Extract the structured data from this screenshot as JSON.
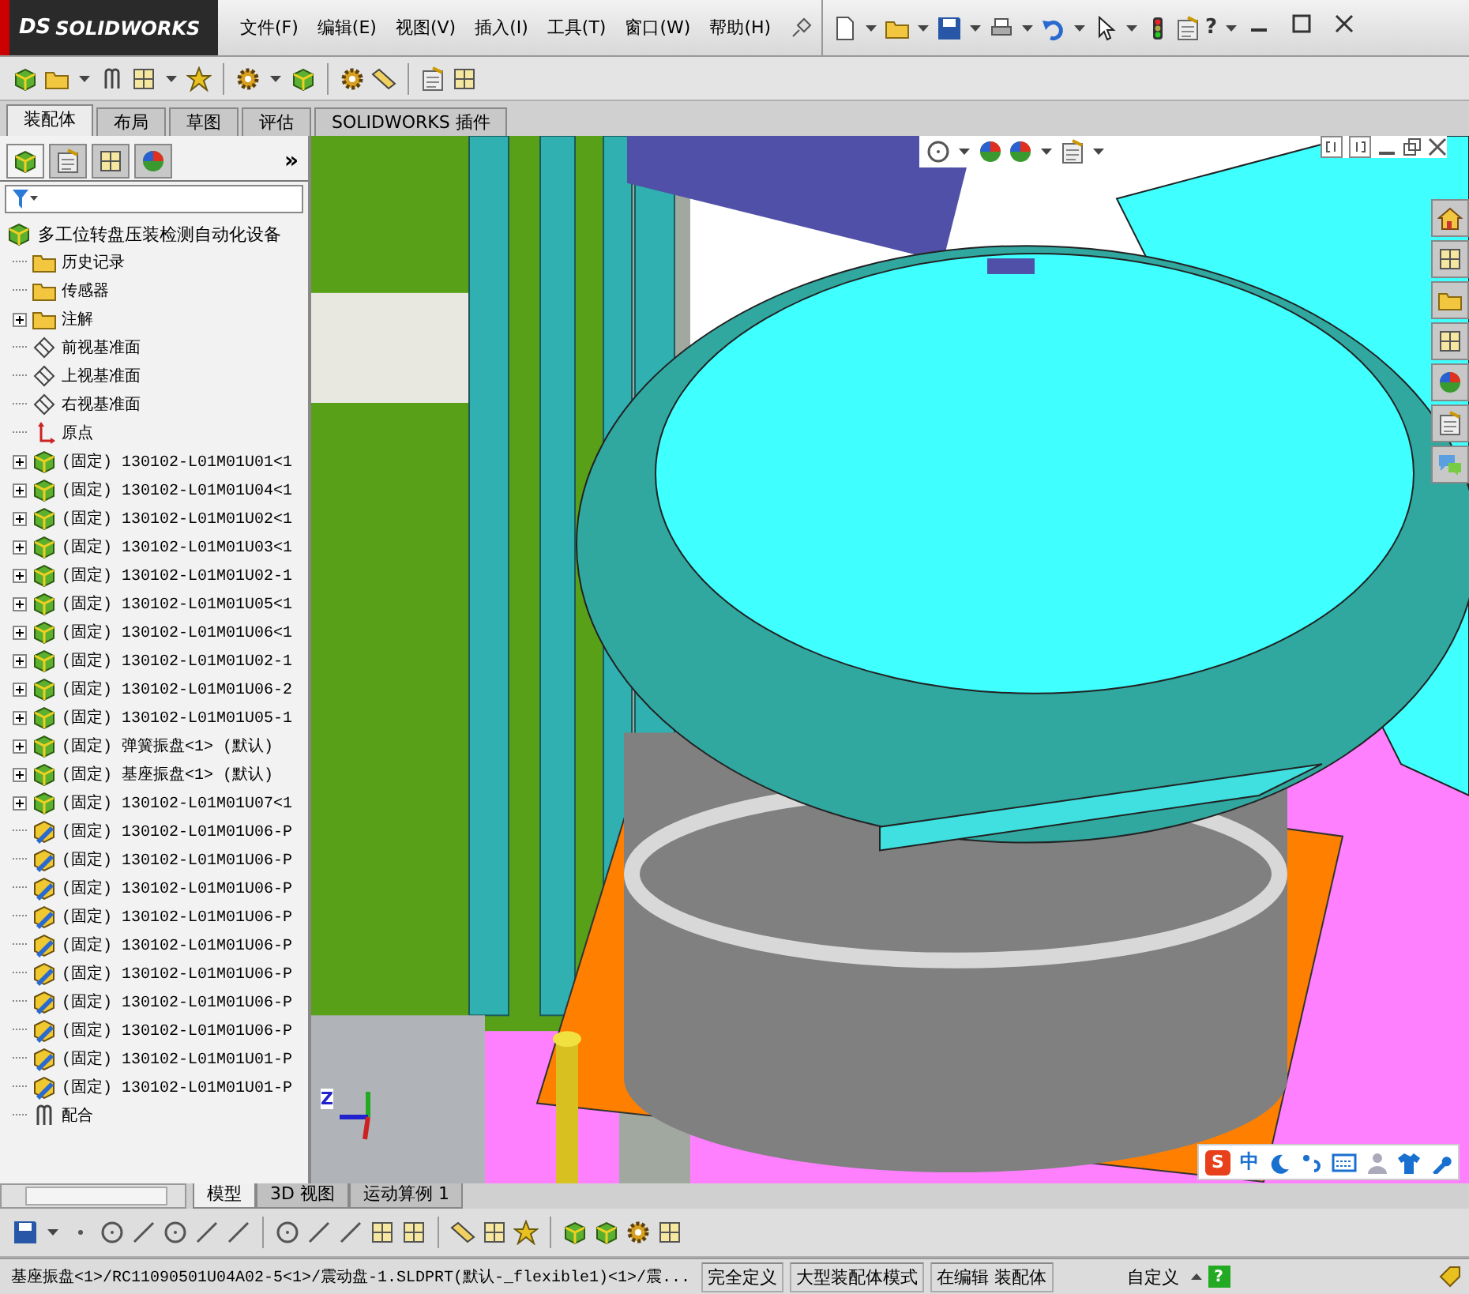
{
  "logo": {
    "mark": "DS",
    "name": "SOLIDWORKS"
  },
  "menu": [
    "文件(F)",
    "编辑(E)",
    "视图(V)",
    "插入(I)",
    "工具(T)",
    "窗口(W)",
    "帮助(H)"
  ],
  "command_tabs": [
    {
      "label": "装配体",
      "selected": true
    },
    {
      "label": "布局",
      "selected": false
    },
    {
      "label": "草图",
      "selected": false
    },
    {
      "label": "评估",
      "selected": false
    },
    {
      "label": "SOLIDWORKS 插件",
      "selected": false
    }
  ],
  "panel_tabs": [
    {
      "kind": "feature",
      "selected": true
    },
    {
      "kind": "property",
      "selected": false
    },
    {
      "kind": "config",
      "selected": false
    },
    {
      "kind": "display",
      "selected": false
    }
  ],
  "panel_more": "»",
  "feature_tree": {
    "root": {
      "label": "多工位转盘压装检测自动化设备",
      "kind": "assembly",
      "children": [
        {
          "label": "历史记录",
          "kind": "history",
          "collapsed": false
        },
        {
          "label": "传感器",
          "kind": "sensor",
          "collapsed": false
        },
        {
          "label": "注解",
          "kind": "annotation",
          "collapsed": true
        },
        {
          "label": "前视基准面",
          "kind": "plane",
          "collapsed": false
        },
        {
          "label": "上视基准面",
          "kind": "plane",
          "collapsed": false
        },
        {
          "label": "右视基准面",
          "kind": "plane",
          "collapsed": false
        },
        {
          "label": "原点",
          "kind": "origin",
          "collapsed": false
        },
        {
          "label": "(固定) 130102-L01M01U01<1",
          "kind": "subassembly",
          "collapsed": true
        },
        {
          "label": "(固定) 130102-L01M01U04<1",
          "kind": "subassembly",
          "collapsed": true
        },
        {
          "label": "(固定) 130102-L01M01U02<1",
          "kind": "subassembly",
          "collapsed": true
        },
        {
          "label": "(固定) 130102-L01M01U03<1",
          "kind": "subassembly",
          "collapsed": true
        },
        {
          "label": "(固定) 130102-L01M01U02-1",
          "kind": "subassembly",
          "collapsed": true
        },
        {
          "label": "(固定) 130102-L01M01U05<1",
          "kind": "subassembly",
          "collapsed": true
        },
        {
          "label": "(固定) 130102-L01M01U06<1",
          "kind": "subassembly",
          "collapsed": true
        },
        {
          "label": "(固定) 130102-L01M01U02-1",
          "kind": "subassembly",
          "collapsed": true
        },
        {
          "label": "(固定) 130102-L01M01U06-2",
          "kind": "subassembly",
          "collapsed": true
        },
        {
          "label": "(固定) 130102-L01M01U05-1",
          "kind": "subassembly",
          "collapsed": true
        },
        {
          "label": "(固定) 弹簧振盘<1> (默认)",
          "kind": "subassembly",
          "collapsed": true
        },
        {
          "label": "(固定) 基座振盘<1> (默认)",
          "kind": "subassembly",
          "collapsed": true
        },
        {
          "label": "(固定) 130102-L01M01U07<1",
          "kind": "subassembly",
          "collapsed": true
        },
        {
          "label": "(固定) 130102-L01M01U06-P",
          "kind": "part",
          "collapsed": false
        },
        {
          "label": "(固定) 130102-L01M01U06-P",
          "kind": "part",
          "collapsed": false
        },
        {
          "label": "(固定) 130102-L01M01U06-P",
          "kind": "part",
          "collapsed": false
        },
        {
          "label": "(固定) 130102-L01M01U06-P",
          "kind": "part",
          "collapsed": false
        },
        {
          "label": "(固定) 130102-L01M01U06-P",
          "kind": "part",
          "collapsed": false
        },
        {
          "label": "(固定) 130102-L01M01U06-P",
          "kind": "part",
          "collapsed": false
        },
        {
          "label": "(固定) 130102-L01M01U06-P",
          "kind": "part",
          "collapsed": false
        },
        {
          "label": "(固定) 130102-L01M01U06-P",
          "kind": "part",
          "collapsed": false
        },
        {
          "label": "(固定) 130102-L01M01U01-P",
          "kind": "part",
          "collapsed": false
        },
        {
          "label": "(固定) 130102-L01M01U01-P",
          "kind": "part",
          "collapsed": false
        },
        {
          "label": "配合",
          "kind": "mates",
          "collapsed": false
        }
      ]
    }
  },
  "quick_toolbar": {
    "help_glyph": "?"
  },
  "viewport": {
    "triad_label": "Z"
  },
  "bottom_tabs": [
    {
      "label": "模型",
      "selected": true
    },
    {
      "label": "3D 视图",
      "selected": false
    },
    {
      "label": "运动算例 1",
      "selected": false
    }
  ],
  "ime_bar": {
    "logo": "S",
    "mode": "中"
  },
  "status_bar": {
    "path": "基座振盘<1>/RC11090501U04A02-5<1>/震动盘-1.SLDPRT(默认-_flexible1)<1>/震...",
    "state": "完全定义",
    "mode": "大型装配体模式",
    "editing": "在编辑 装配体",
    "units": "自定义",
    "help_glyph": "?"
  }
}
